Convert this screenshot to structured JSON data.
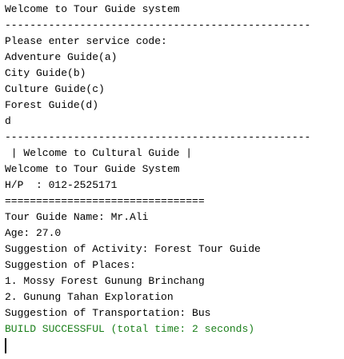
{
  "console": {
    "lines": [
      "Welcome to Tour Guide system",
      "-------------------------------------------------",
      "Please enter service code:",
      "Adventure Guide(a)",
      "City Guide(b)",
      "Culture Guide(c)",
      "Forest Guide(d)",
      "d",
      "-------------------------------------------------",
      " | Welcome to Cultural Guide |",
      "Welcome to Tour Guide System",
      "H/P  : 012-2525171",
      "================================",
      "Tour Guide Name: Mr.Ali",
      "Age: 27.0",
      "Suggestion of Activity: Forest Tour Guide",
      "Suggestion of Places:",
      "1. Mossy Forest Gunung Brinchang",
      "2. Gunung Tahan Exploration",
      "Suggestion of Transportation: Bus"
    ],
    "build_status": "BUILD SUCCESSFUL (total time: 2 seconds)",
    "colors": {
      "text": "#000000",
      "success": "#1a7f1a",
      "background": "#ffffff"
    }
  }
}
